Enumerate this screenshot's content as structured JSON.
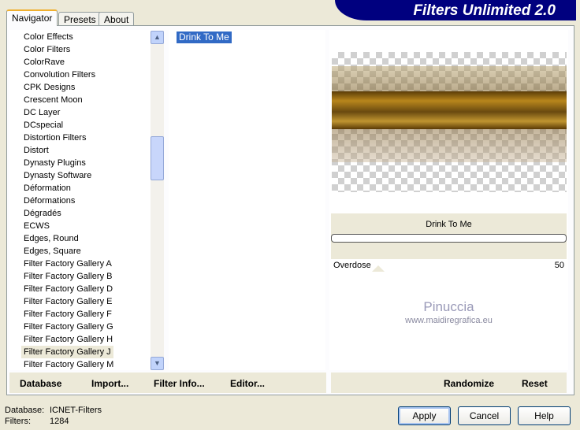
{
  "banner": {
    "title": "Filters Unlimited 2.0"
  },
  "tabs": [
    {
      "label": "Navigator"
    },
    {
      "label": "Presets"
    },
    {
      "label": "About"
    }
  ],
  "categories": [
    "Color Effects",
    "Color Filters",
    "ColorRave",
    "Convolution Filters",
    "CPK Designs",
    "Crescent Moon",
    "DC Layer",
    "DCspecial",
    "Distortion Filters",
    "Distort",
    "Dynasty Plugins",
    "Dynasty Software",
    "Déformation",
    "Déformations",
    "Dégradés",
    "ECWS",
    "Edges, Round",
    "Edges, Square",
    "Filter Factory Gallery A",
    "Filter Factory Gallery B",
    "Filter Factory Gallery D",
    "Filter Factory Gallery E",
    "Filter Factory Gallery F",
    "Filter Factory Gallery G",
    "Filter Factory Gallery H",
    "Filter Factory Gallery J",
    "Filter Factory Gallery M"
  ],
  "selected_category": "Filter Factory Gallery J",
  "filters": [
    "Drink To Me"
  ],
  "preview": {
    "filter_name": "Drink To Me",
    "progress": 0
  },
  "sliders": [
    {
      "label": "Overdose",
      "value": "50",
      "fraction": 0.2
    }
  ],
  "watermark": {
    "name": "Pinuccia",
    "url": "www.maidiregrafica.eu"
  },
  "left_buttons": {
    "database": "Database",
    "import": "Import...",
    "filter_info": "Filter Info...",
    "editor": "Editor..."
  },
  "right_buttons": {
    "randomize": "Randomize",
    "reset": "Reset"
  },
  "status": {
    "database_label": "Database:",
    "database_value": "ICNET-Filters",
    "filters_label": "Filters:",
    "filters_value": "1284"
  },
  "dialog_buttons": {
    "apply": "Apply",
    "cancel": "Cancel",
    "help": "Help"
  }
}
